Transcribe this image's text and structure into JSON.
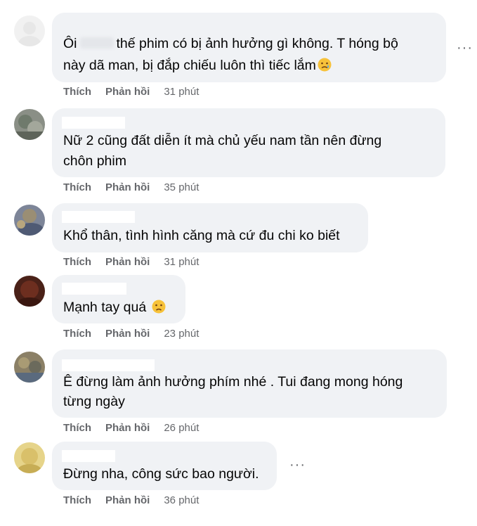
{
  "comments": [
    {
      "line1_pre": "Ôi",
      "line1_post": "thế phim có bị ảnh hưởng gì không. T hóng bộ",
      "line2": "này dã man, bị đắp chiếu luôn thì tiếc lắm",
      "like": "Thích",
      "reply": "Phản hồi",
      "time": "31 phút",
      "emoji": "sad-tear-emoji",
      "more": "···"
    },
    {
      "line1": "Nữ 2 cũng đất diễn ít mà chủ yếu nam tần nên đừng",
      "line2": "chôn phim",
      "like": "Thích",
      "reply": "Phản hồi",
      "time": "35 phút"
    },
    {
      "line1": "Khổ thân, tình hình căng mà cứ đu chi ko biết",
      "like": "Thích",
      "reply": "Phản hồi",
      "time": "31 phút"
    },
    {
      "line1": "Mạnh tay quá",
      "like": "Thích",
      "reply": "Phản hồi",
      "time": "23 phút",
      "emoji": "frown-emoji"
    },
    {
      "line1": "Ê đừng làm ảnh hưởng phím nhé . Tui đang mong hóng",
      "line2": "từng ngày",
      "like": "Thích",
      "reply": "Phản hồi",
      "time": "26 phút"
    },
    {
      "line1": "Đừng nha, công sức bao người.",
      "like": "Thích",
      "reply": "Phản hồi",
      "time": "36 phút",
      "more": "···"
    }
  ],
  "colors": {
    "bubble": "#f0f2f5",
    "meta": "#65676b",
    "text": "#050505"
  }
}
